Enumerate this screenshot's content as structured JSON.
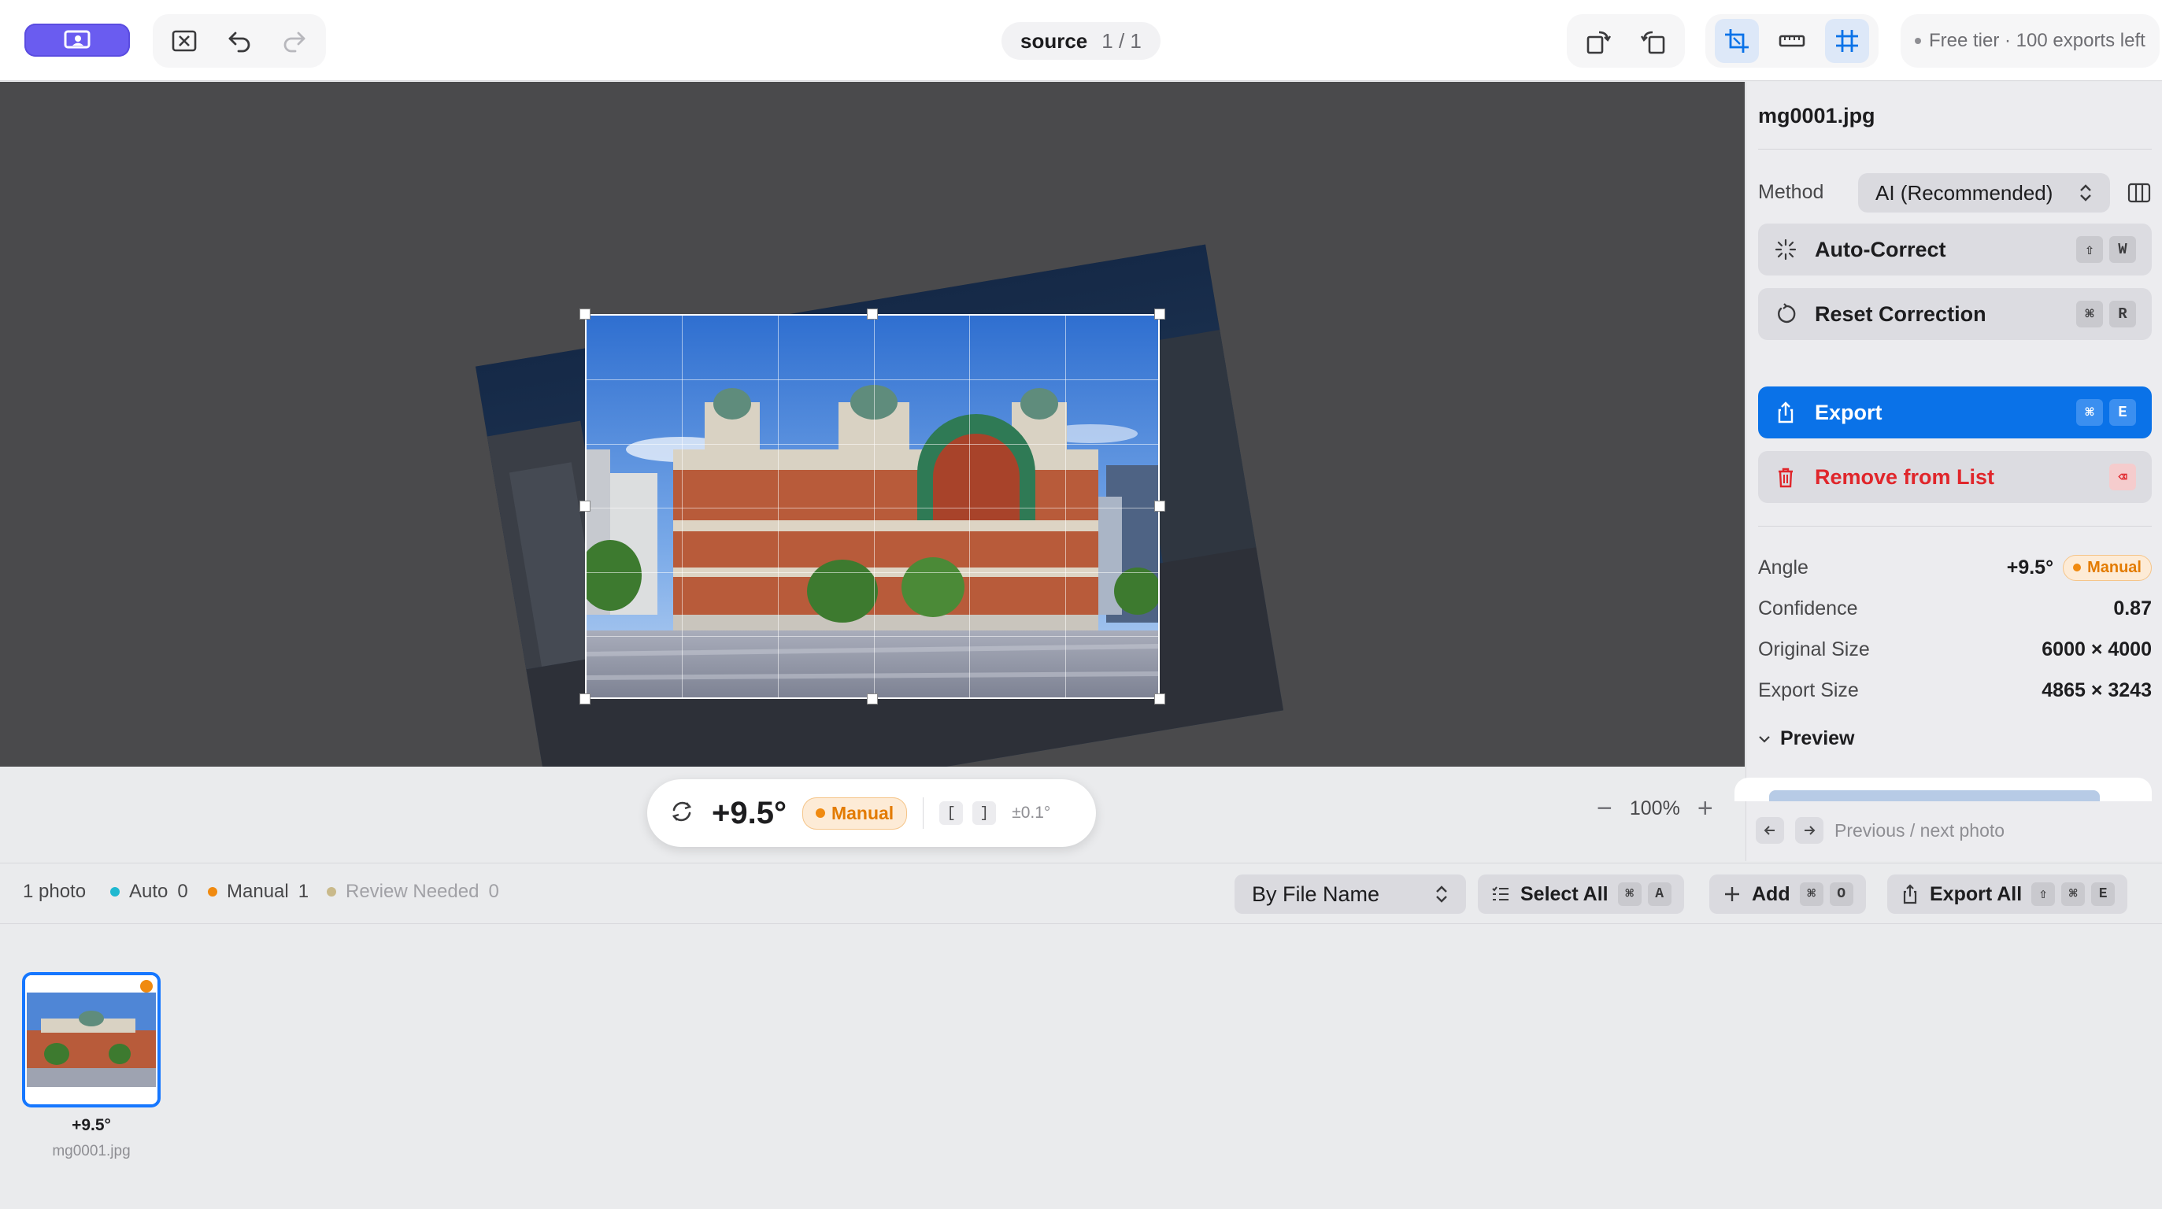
{
  "toolbar": {
    "source_name": "source",
    "source_count": "1 / 1",
    "tier_text": "Free tier · 100 exports left"
  },
  "angle_bar": {
    "angle": "+9.5°",
    "badge": "Manual",
    "key_left": "[",
    "key_right": "]",
    "step": "±0.1°",
    "zoom": "100%"
  },
  "panel": {
    "filename": "mg0001.jpg",
    "method_label": "Method",
    "method_value": "AI (Recommended)",
    "buttons": [
      {
        "label": "Auto-Correct",
        "keys": [
          "⇧",
          "W"
        ]
      },
      {
        "label": "Reset Correction",
        "keys": [
          "⌘",
          "R"
        ]
      },
      {
        "label": "Export",
        "keys": [
          "⌘",
          "E"
        ]
      },
      {
        "label": "Remove from List",
        "keys": [
          "⌫"
        ]
      }
    ],
    "info": [
      {
        "key": "Angle",
        "value": "+9.5°"
      },
      {
        "key": "Confidence",
        "value": "0.87"
      },
      {
        "key": "Original Size",
        "value": "6000 × 4000"
      },
      {
        "key": "Export Size",
        "value": "4865 × 3243"
      }
    ],
    "angle_badge": "Manual",
    "preview_label": "Preview",
    "nav_hint": "Previous / next photo"
  },
  "status": {
    "photo_count": "1 photo",
    "auto_label": "Auto",
    "auto_count": "0",
    "manual_label": "Manual",
    "manual_count": "1",
    "review_label": "Review Needed",
    "review_count": "0",
    "sort_value": "By File Name",
    "select_all": "Select All",
    "select_keys": [
      "⌘",
      "A"
    ],
    "add": "Add",
    "add_keys": [
      "⌘",
      "O"
    ],
    "export_all": "Export All",
    "export_all_keys": [
      "⇧",
      "⌘",
      "E"
    ]
  },
  "thumbnails": [
    {
      "angle": "+9.5°",
      "name": "mg0001.jpg"
    }
  ],
  "colors": {
    "accent": "#0a72e8",
    "app_button": "#6a5cf0",
    "manual": "#f08a10",
    "auto": "#1fb8d0",
    "review": "#c9b98a",
    "danger": "#e0262b",
    "canvas": "#4a4a4c"
  }
}
